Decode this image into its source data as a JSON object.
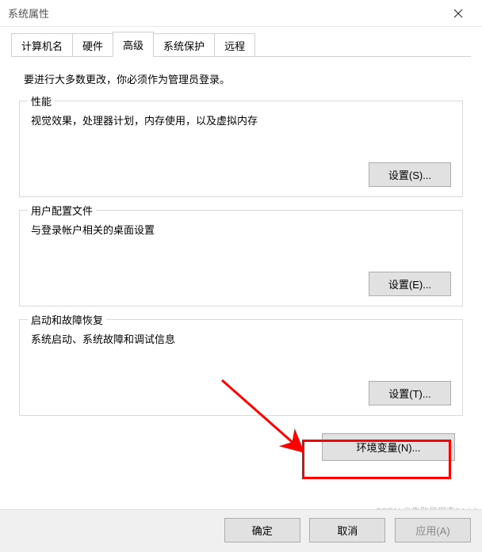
{
  "window": {
    "title": "系统属性"
  },
  "tabs": {
    "computer_name": "计算机名",
    "hardware": "硬件",
    "advanced": "高级",
    "system_protection": "系统保护",
    "remote": "远程"
  },
  "advanced": {
    "intro": "要进行大多数更改，你必须作为管理员登录。",
    "performance": {
      "legend": "性能",
      "desc": "视觉效果，处理器计划，内存使用，以及虚拟内存",
      "button": "设置(S)..."
    },
    "user_profiles": {
      "legend": "用户配置文件",
      "desc": "与登录帐户相关的桌面设置",
      "button": "设置(E)..."
    },
    "startup_recovery": {
      "legend": "启动和故障恢复",
      "desc": "系统启动、系统故障和调试信息",
      "button": "设置(T)..."
    },
    "env_vars_button": "环境变量(N)..."
  },
  "footer": {
    "ok": "确定",
    "cancel": "取消",
    "apply": "应用(A)"
  },
  "watermark": "CSDN @失败是常态('へ'、)"
}
